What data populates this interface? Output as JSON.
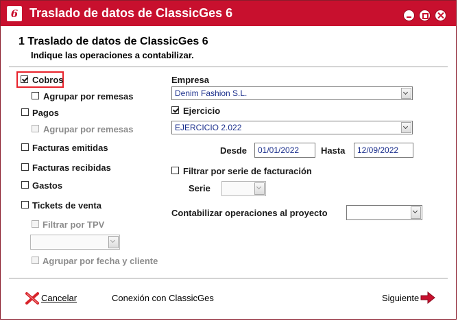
{
  "window": {
    "title": "Traslado de datos de ClassicGes 6",
    "app_icon_letter": "6"
  },
  "step": {
    "number": "1",
    "title": "Traslado de datos de ClassicGes 6",
    "subtitle": "Indique las operaciones a contabilizar."
  },
  "options": {
    "cobros": {
      "label": "Cobros",
      "checked": true
    },
    "cobros_agrupar": {
      "label": "Agrupar por remesas",
      "checked": false
    },
    "pagos": {
      "label": "Pagos",
      "checked": false
    },
    "pagos_agrupar": {
      "label": "Agrupar por remesas",
      "checked": false,
      "disabled": true
    },
    "facturas_emitidas": {
      "label": "Facturas emitidas",
      "checked": false
    },
    "facturas_recibidas": {
      "label": "Facturas recibidas",
      "checked": false
    },
    "gastos": {
      "label": "Gastos",
      "checked": false
    },
    "tickets": {
      "label": "Tickets de venta",
      "checked": false
    },
    "filtrar_tpv": {
      "label": "Filtrar por TPV",
      "checked": false,
      "disabled": true
    },
    "tpv_select": {
      "value": ""
    },
    "agrupar_fecha": {
      "label": "Agrupar por fecha y cliente",
      "checked": false,
      "disabled": true
    }
  },
  "right": {
    "empresa_label": "Empresa",
    "empresa_value": "Denim Fashion S.L.",
    "ejercicio": {
      "label": "Ejercicio",
      "checked": true
    },
    "ejercicio_value": "EJERCICIO 2.022",
    "desde_label": "Desde",
    "desde_value": "01/01/2022",
    "hasta_label": "Hasta",
    "hasta_value": "12/09/2022",
    "filtrar_serie": {
      "label": "Filtrar por serie de facturación",
      "checked": false
    },
    "serie_label": "Serie",
    "serie_value": "",
    "proyecto_label": "Contabilizar operaciones al proyecto",
    "proyecto_value": ""
  },
  "footer": {
    "cancel_label": "Cancelar",
    "connection_label": "Conexión con ClassicGes",
    "next_label": "Siguiente"
  },
  "colors": {
    "titlebar": "#c8102e",
    "highlight": "#e8222b",
    "value_text": "#1a2e8c"
  }
}
